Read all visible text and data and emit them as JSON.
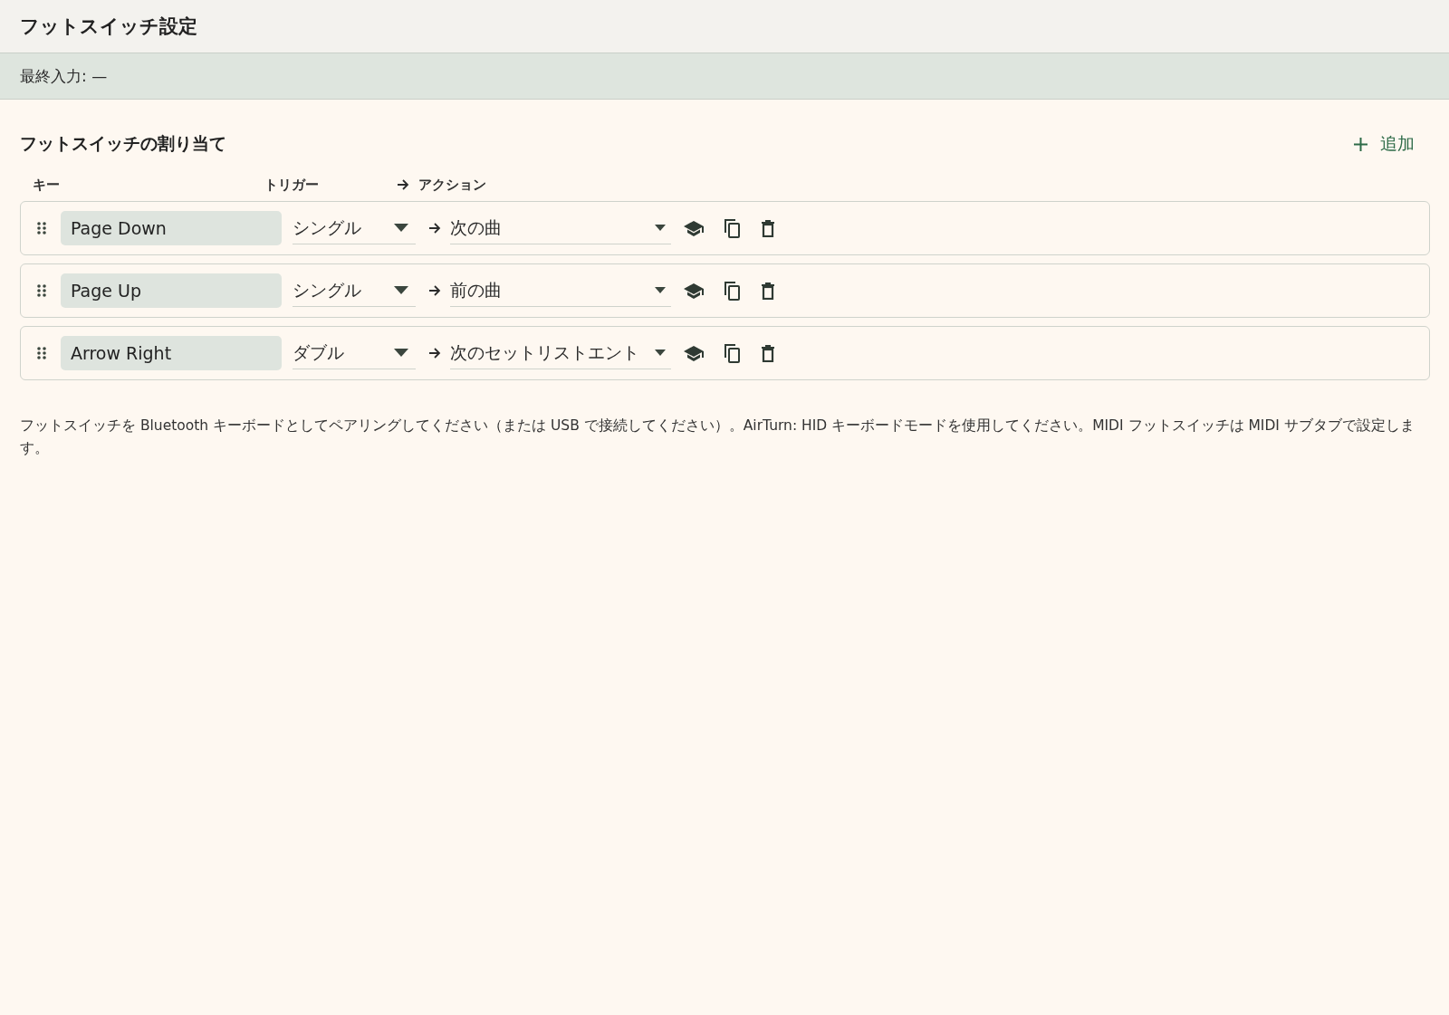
{
  "window": {
    "title": "フットスイッチ設定"
  },
  "status_bar": {
    "text": "最終入力: —"
  },
  "section": {
    "title": "フットスイッチの割り当て",
    "add_button": "追加"
  },
  "columns": [
    "キー",
    "トリガー",
    "アクション"
  ],
  "mappings": [
    {
      "key": "Page Down",
      "trigger": "シングル",
      "action": "次の曲"
    },
    {
      "key": "Page Up",
      "trigger": "シングル",
      "action": "前の曲"
    },
    {
      "key": "Arrow Right",
      "trigger": "ダブル",
      "action": "次のセットリストエント"
    }
  ],
  "help_text": "フットスイッチを Bluetooth キーボードとしてペアリングしてください（または USB で接続してください）。AirTurn: HID キーボードモードを使用してください。MIDI フットスイッチは MIDI サブタブで設定します。"
}
